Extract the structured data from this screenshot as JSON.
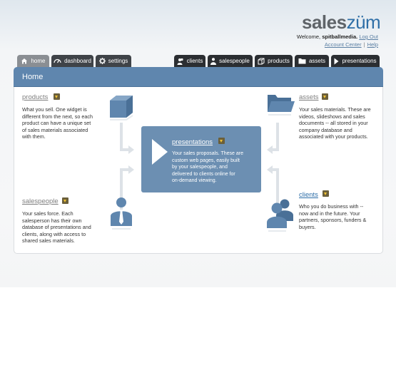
{
  "header": {
    "logo_part1": "sales",
    "logo_part2": "züm",
    "welcome_prefix": "Welcome, ",
    "username": "spitballmedia.",
    "logout_label": "Log Out",
    "account_center_label": "Account Center",
    "separator": "|",
    "help_label": "Help"
  },
  "tabs_left": [
    {
      "label": "home",
      "icon": "home-icon"
    },
    {
      "label": "dashboard",
      "icon": "dashboard-icon"
    },
    {
      "label": "settings",
      "icon": "gear-icon"
    }
  ],
  "tabs_right": [
    {
      "label": "clients",
      "icon": "clients-icon"
    },
    {
      "label": "salespeople",
      "icon": "person-icon"
    },
    {
      "label": "products",
      "icon": "products-icon"
    },
    {
      "label": "assets",
      "icon": "folder-icon"
    },
    {
      "label": "presentations",
      "icon": "play-icon"
    }
  ],
  "panel": {
    "title": "Home"
  },
  "sections": {
    "products": {
      "title": "products",
      "text": [
        "What you sell. One widget is",
        "different from the next, so each",
        "product can have a unique set",
        "of sales materials associated",
        "with them."
      ]
    },
    "assets": {
      "title": "assets",
      "text": [
        "Your sales materials. These are",
        "videos, slideshows and sales",
        "documents -- all stored in your",
        "company database and",
        "associated with your products."
      ]
    },
    "presentations": {
      "title": "presentations",
      "text": [
        "Your sales proposals. These are",
        "custom web pages, easily built",
        "by your salespeople, and",
        "delivered to clients online for",
        "on-demand viewing."
      ]
    },
    "salespeople": {
      "title": "salespeople",
      "text": [
        "Your sales force. Each",
        "salesperson has their own",
        "database of presentations and",
        "clients, along with access to",
        "shared sales materials."
      ]
    },
    "clients": {
      "title": "clients",
      "text": [
        "Who you do business with --",
        "now and in the future. Your",
        "partners, sponsors, funders &",
        "buyers."
      ]
    }
  },
  "colors": {
    "accent": "#2f6fa7",
    "panel_header": "#5f86ae",
    "center_box": "#6c8fb2",
    "icon_blue": "#5f86ae"
  }
}
